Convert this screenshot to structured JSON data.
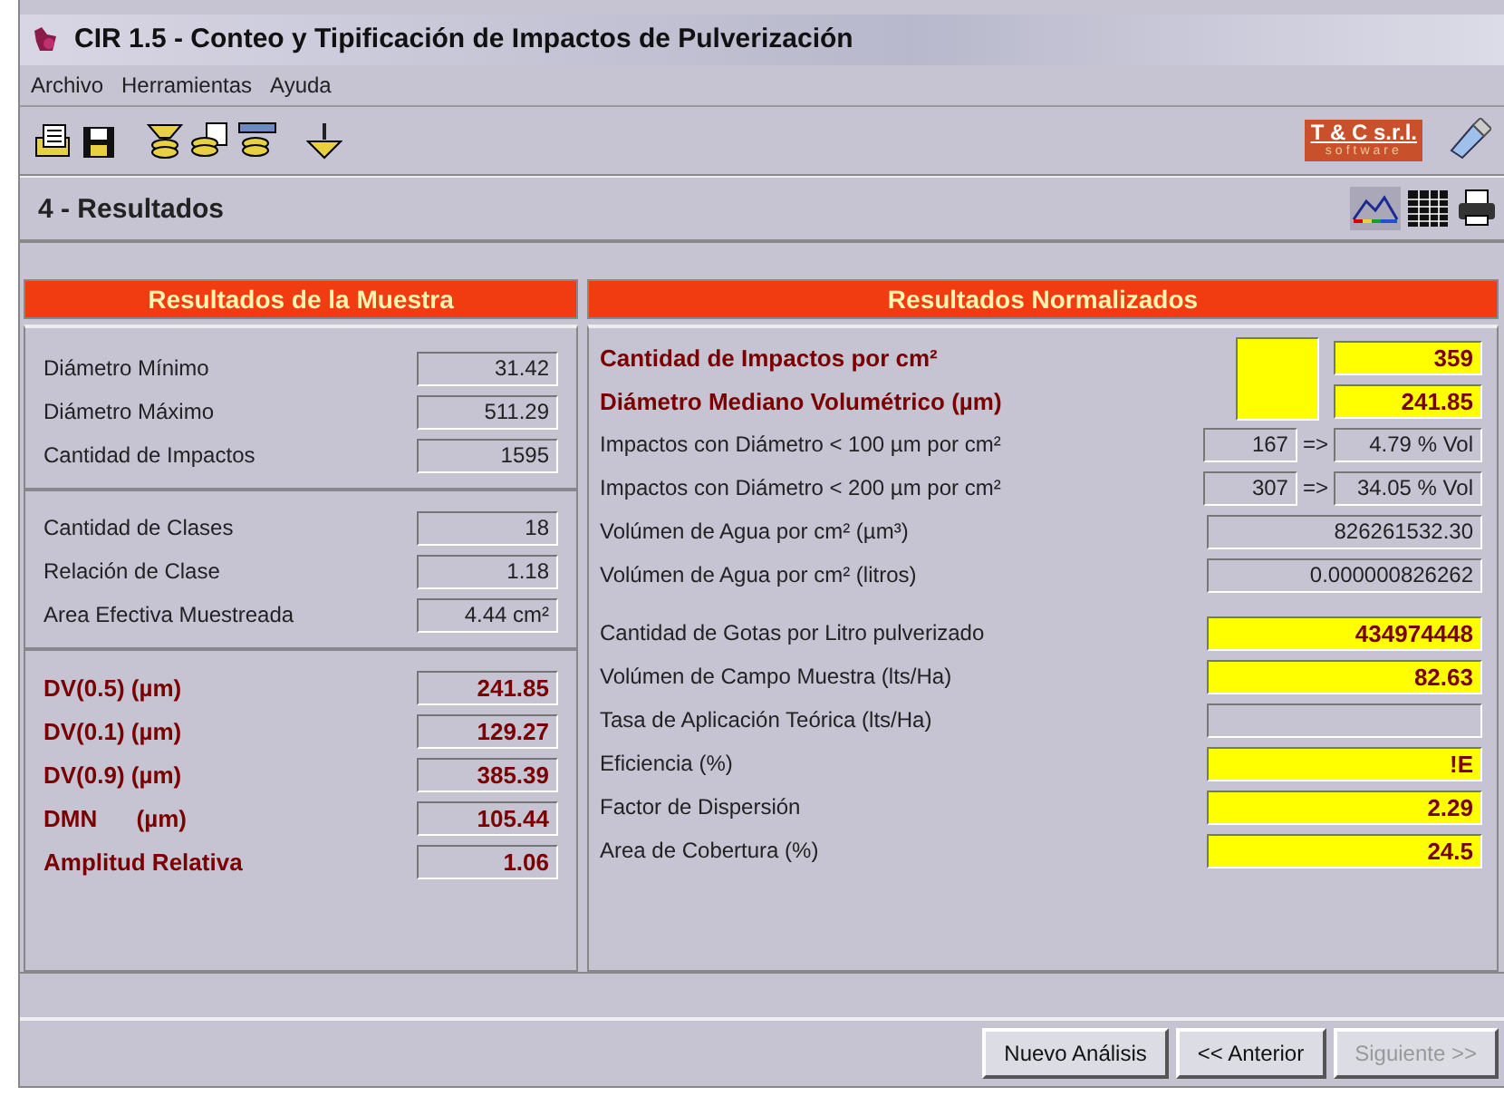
{
  "window": {
    "title": "CIR 1.5 - Conteo y Tipificación de Impactos de Pulverización"
  },
  "menu": [
    "Archivo",
    "Herramientas",
    "Ayuda"
  ],
  "brand": {
    "name": "T & C s.r.l.",
    "tagline": "software"
  },
  "step": {
    "title": "4 - Resultados"
  },
  "sample": {
    "title": "Resultados de la Muestra",
    "groups": [
      [
        {
          "label": "Diámetro Mínimo",
          "value": "31.42",
          "kind": "plain"
        },
        {
          "label": "Diámetro Máximo",
          "value": "511.29",
          "kind": "plain"
        },
        {
          "label": "Cantidad de Impactos",
          "value": "1595",
          "kind": "plain"
        }
      ],
      [
        {
          "label": "Cantidad de Clases",
          "value": "18",
          "kind": "plain"
        },
        {
          "label": "Relación de Clase",
          "value": "1.18",
          "kind": "plain"
        },
        {
          "label": "Area Efectiva Muestreada",
          "value": "4.44 cm²",
          "kind": "plain"
        }
      ],
      [
        {
          "label": "DV(0.5) (µm)",
          "value": "241.85",
          "kind": "key"
        },
        {
          "label": "DV(0.1) (µm)",
          "value": "129.27",
          "kind": "key"
        },
        {
          "label": "DV(0.9) (µm)",
          "value": "385.39",
          "kind": "key"
        },
        {
          "label": "DMN      (µm)",
          "value": "105.44",
          "kind": "key"
        },
        {
          "label": "Amplitud Relativa",
          "value": "1.06",
          "kind": "key"
        }
      ]
    ]
  },
  "normalized": {
    "title": "Resultados Normalizados",
    "rows": [
      {
        "kind": "key",
        "label": "Cantidad de Impactos por cm²",
        "value": "359"
      },
      {
        "kind": "key",
        "label": "Diámetro Mediano Volumétrico (µm)",
        "value": "241.85"
      },
      {
        "kind": "ratio",
        "label": "Impactos con Diámetro < 100 µm por cm²",
        "value": "167",
        "arrow": "=>",
        "share": "4.79 % Vol"
      },
      {
        "kind": "ratio",
        "label": "Impactos con Diámetro < 200 µm por cm²",
        "value": "307",
        "arrow": "=>",
        "share": "34.05 % Vol"
      },
      {
        "kind": "plain",
        "label": "Volúmen de Agua por cm² (µm³)",
        "value": "826261532.30"
      },
      {
        "kind": "plain",
        "label": "Volúmen de Agua por cm² (litros)",
        "value": "0.000000826262"
      },
      {
        "kind": "yellow",
        "label": "Cantidad de Gotas por Litro pulverizado",
        "value": "434974448"
      },
      {
        "kind": "yellow",
        "label": "Volúmen de Campo Muestra (lts/Ha)",
        "value": "82.63"
      },
      {
        "kind": "plain",
        "label": "Tasa de Aplicación Teórica (lts/Ha)"
      },
      {
        "kind": "yellow",
        "label": "Eficiencia (%)",
        "value": "!E"
      },
      {
        "kind": "yellow",
        "label": "Factor de Dispersión",
        "value": "2.29"
      },
      {
        "kind": "yellow",
        "label": "Area de Cobertura (%)",
        "value": "24.5"
      }
    ]
  },
  "buttons": [
    {
      "label": "Nuevo Análisis",
      "disabled": false
    },
    {
      "label": "<< Anterior",
      "disabled": false
    },
    {
      "label": "Siguiente >>",
      "disabled": true
    }
  ]
}
